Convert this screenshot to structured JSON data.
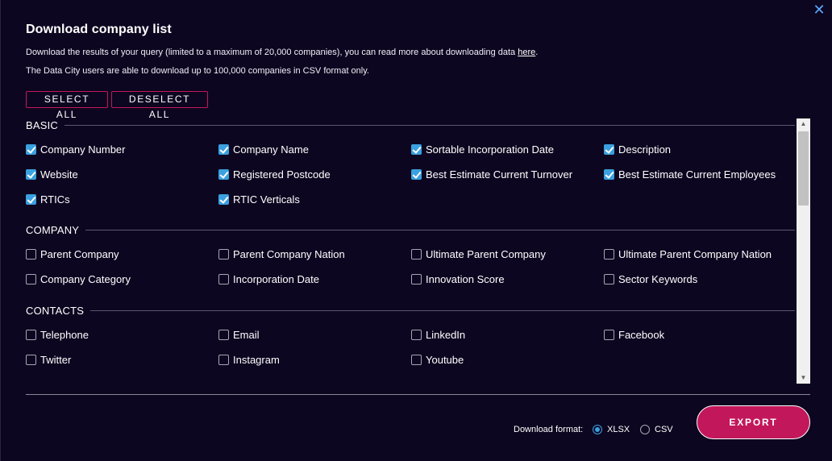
{
  "dialog": {
    "title": "Download company list",
    "desc_before_link": "Download the results of your query (limited to a maximum of 20,000 companies), you can read more about downloading data ",
    "desc_link": "here",
    "desc_after_link": ".",
    "desc2": "The Data City users are able to download up to 100,000 companies in CSV format only.",
    "close_label": "✕"
  },
  "actions": {
    "select_all": "SELECT ALL",
    "deselect_all": "DESELECT ALL",
    "export": "EXPORT"
  },
  "sections": {
    "basic": {
      "label": "BASIC",
      "items": [
        {
          "label": "Company Number",
          "checked": true
        },
        {
          "label": "Company Name",
          "checked": true
        },
        {
          "label": "Sortable Incorporation Date",
          "checked": true
        },
        {
          "label": "Description",
          "checked": true
        },
        {
          "label": "Website",
          "checked": true
        },
        {
          "label": "Registered Postcode",
          "checked": true
        },
        {
          "label": "Best Estimate Current Turnover",
          "checked": true
        },
        {
          "label": "Best Estimate Current Employees",
          "checked": true
        },
        {
          "label": "RTICs",
          "checked": true
        },
        {
          "label": "RTIC Verticals",
          "checked": true
        }
      ]
    },
    "company": {
      "label": "COMPANY",
      "items": [
        {
          "label": "Parent Company",
          "checked": false
        },
        {
          "label": "Parent Company Nation",
          "checked": false
        },
        {
          "label": "Ultimate Parent Company",
          "checked": false
        },
        {
          "label": "Ultimate Parent Company Nation",
          "checked": false
        },
        {
          "label": "Company Category",
          "checked": false
        },
        {
          "label": "Incorporation Date",
          "checked": false
        },
        {
          "label": "Innovation Score",
          "checked": false
        },
        {
          "label": "Sector Keywords",
          "checked": false
        }
      ]
    },
    "contacts": {
      "label": "CONTACTS",
      "items": [
        {
          "label": "Telephone",
          "checked": false
        },
        {
          "label": "Email",
          "checked": false
        },
        {
          "label": "LinkedIn",
          "checked": false
        },
        {
          "label": "Facebook",
          "checked": false
        },
        {
          "label": "Twitter",
          "checked": false
        },
        {
          "label": "Instagram",
          "checked": false
        },
        {
          "label": "Youtube",
          "checked": false
        }
      ]
    }
  },
  "format": {
    "label": "Download format:",
    "options": [
      {
        "label": "XLSX",
        "selected": true
      },
      {
        "label": "CSV",
        "selected": false
      }
    ]
  },
  "colors": {
    "background": "#0d0620",
    "accent": "#c2185b",
    "checkbox": "#3aa0e0"
  }
}
